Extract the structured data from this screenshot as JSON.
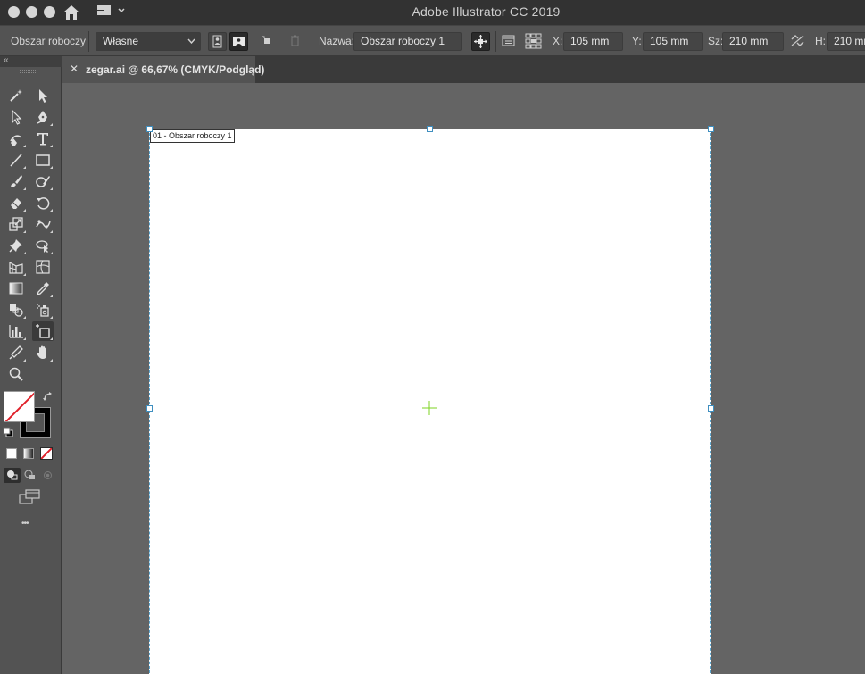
{
  "app": {
    "title": "Adobe Illustrator CC 2019"
  },
  "control_bar": {
    "artboard_label": "Obszar roboczy",
    "preset_value": "Własne",
    "name_label": "Nazwa:",
    "name_value": "Obszar roboczy 1",
    "x_label": "X:",
    "x_value": "105 mm",
    "y_label": "Y:",
    "y_value": "105 mm",
    "width_label": "Sz:",
    "width_value": "210 mm",
    "height_label": "H:",
    "height_value": "210 mm"
  },
  "document_tab": {
    "close_glyph": "✕",
    "title": "zegar.ai @ 66,67% (CMYK/Podgląd)"
  },
  "toolbar": {
    "collapse_glyph": "«",
    "more_glyph": "•••"
  },
  "artboard": {
    "label": "01 - Obszar roboczy 1"
  },
  "colors": {
    "accent_selection": "#3f8fc0",
    "center_mark": "#7ed321",
    "none_swatch_slash": "#e0202a"
  }
}
